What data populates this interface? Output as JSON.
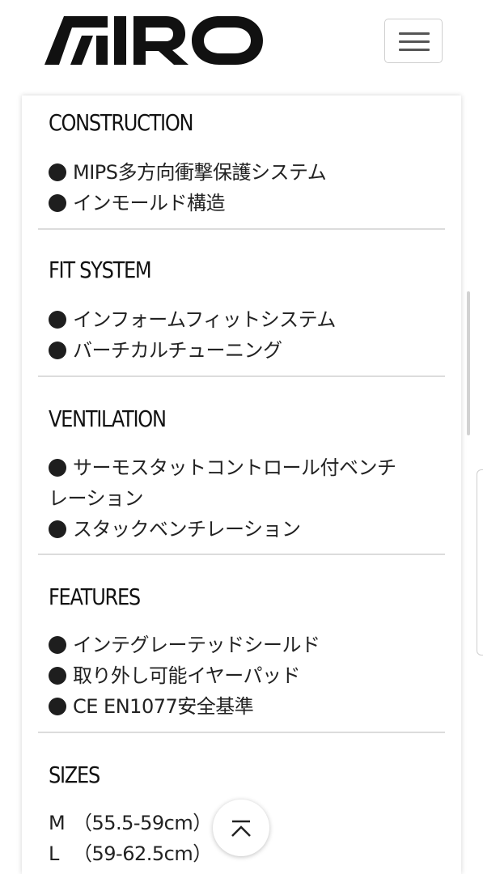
{
  "header": {
    "brand": "GIRO",
    "menu_icon": "hamburger-icon"
  },
  "sections": [
    {
      "title": "CONSTRUCTION",
      "items": [
        "MIPS多方向衝撃保護システム",
        "インモールド構造"
      ]
    },
    {
      "title": "FIT SYSTEM",
      "items": [
        "インフォームフィットシステム",
        "バーチカルチューニング"
      ]
    },
    {
      "title": "VENTILATION",
      "items": [
        "サーモスタットコントロール付ベンチ",
        "レーション",
        "スタックベンチレーション"
      ]
    },
    {
      "title": "FEATURES",
      "items": [
        "インテグレーテッドシールド",
        "取り外し可能イヤーパッド",
        "CE EN1077安全基準"
      ]
    },
    {
      "title": "SIZES",
      "sizes": [
        {
          "label": "M",
          "range": "（55.5-59cm）"
        },
        {
          "label": "L",
          "range": "（59-62.5cm）"
        }
      ]
    }
  ],
  "back_to_top": {
    "icon": "chevron-up-to-top-icon"
  }
}
